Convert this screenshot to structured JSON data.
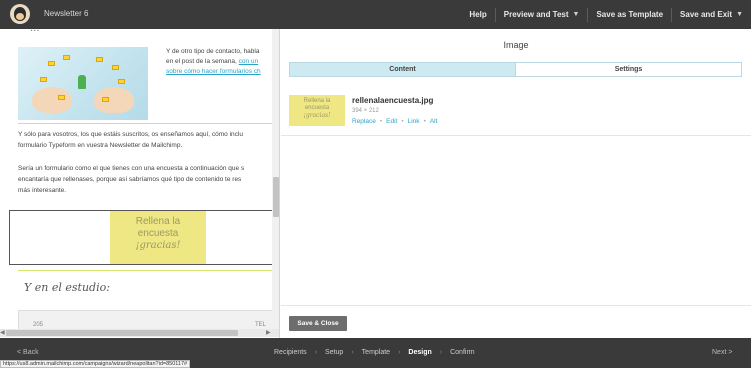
{
  "topbar": {
    "campaign_title": "Newsletter 6",
    "help": "Help",
    "preview_test": "Preview and Test",
    "save_template": "Save as Template",
    "save_exit": "Save and Exit"
  },
  "preview": {
    "script_heading_top": "...",
    "intro_lines": [
      "Y de otro tipo de contacto, habla",
      "en el post de la semana,"
    ],
    "intro_link_inline": "con un",
    "intro_link_line": "sobre cómo hacer formularios ch",
    "para1": [
      "Y sólo para vosotros, los que estáis suscritos, os enseñamos aquí, cómo inclu",
      "formulario Typeform en vuestra Newsletter de Mailchimp."
    ],
    "para2": [
      "Sería un formulario como el que tienes con una encuesta a continuación que s",
      "encantaría que rellenases, porque así sabríamos qué tipo de contenido te res",
      "más interesante."
    ],
    "cta": {
      "line1": "Rellena la",
      "line2": "encuesta",
      "line3": "¡gracias!"
    },
    "studio_heading": "Y en el estudio:",
    "studio_card_left": "205",
    "studio_card_right": "TEL"
  },
  "panel": {
    "title": "Image",
    "tabs": [
      {
        "label": "Content",
        "active": true
      },
      {
        "label": "Settings",
        "active": false
      }
    ],
    "file": {
      "name": "rellenalaencuesta.jpg",
      "dimensions": "394 × 212",
      "thumb_line1": "Rellena la",
      "thumb_line2": "encuesta",
      "thumb_line3": "¡gracias!",
      "actions": [
        "Replace",
        "Edit",
        "Link",
        "Alt"
      ]
    },
    "save_close": "Save & Close"
  },
  "bottombar": {
    "back": "< Back",
    "steps": [
      "Recipients",
      "Setup",
      "Template",
      "Design",
      "Confirm"
    ],
    "active_step": "Design",
    "next": "Next >",
    "status_url": "https://us8.admin.mailchimp.com/campaigns/wizard/neapolitan?id=850117#"
  },
  "colors": {
    "bar": "#3a3a3a",
    "tab_active": "#cde9f2",
    "link": "#2aa3c9",
    "cta_yellow": "#efe784",
    "divider_green": "#d6e66b",
    "button": "#6d6d6d"
  }
}
